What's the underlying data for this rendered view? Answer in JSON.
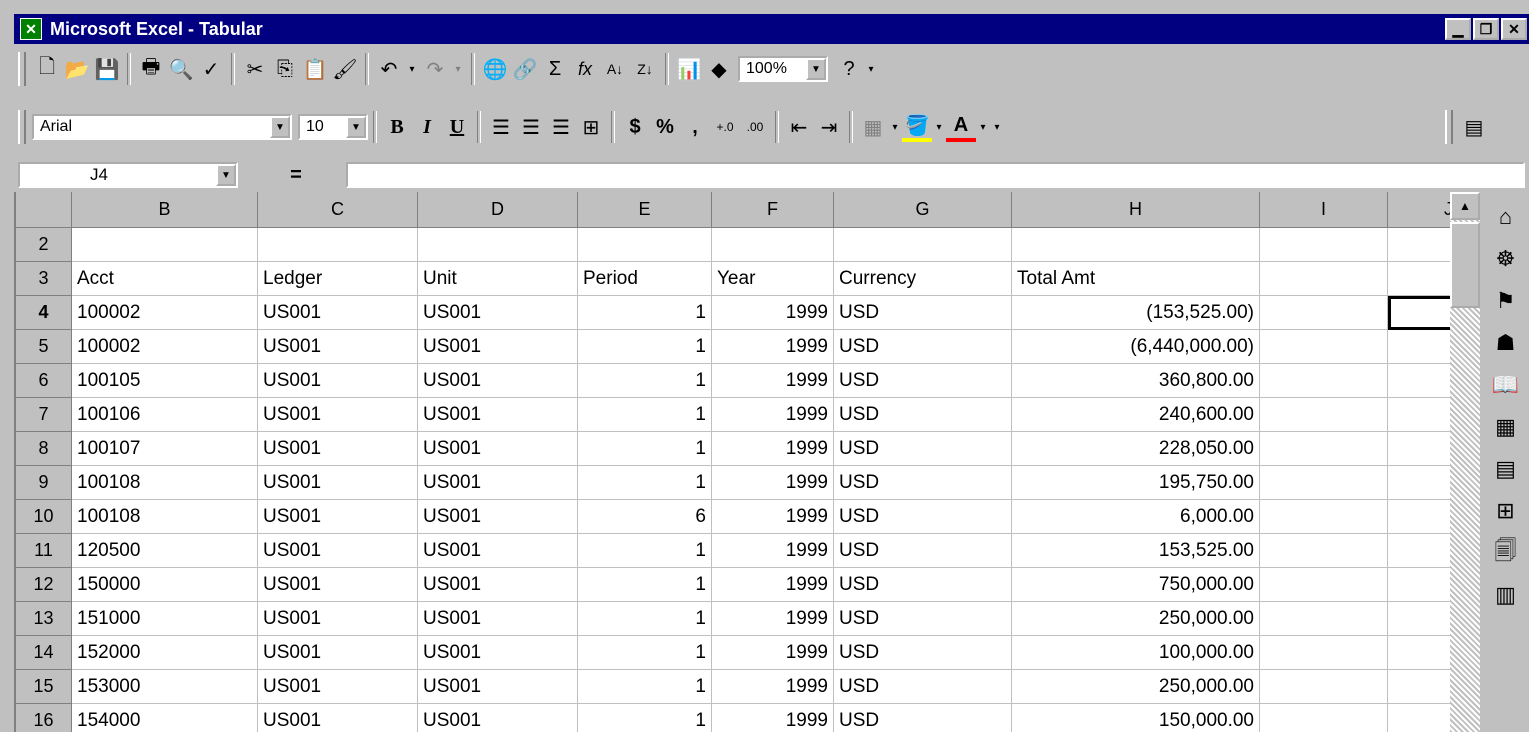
{
  "window": {
    "title": "Microsoft Excel - Tabular"
  },
  "toolbar": {
    "zoom": "100%"
  },
  "format": {
    "font": "Arial",
    "size": "10"
  },
  "formula": {
    "cell_ref": "J4",
    "eq": "="
  },
  "columns": [
    "B",
    "C",
    "D",
    "E",
    "F",
    "G",
    "H",
    "I",
    "J"
  ],
  "rows": [
    {
      "n": "2",
      "cells": [
        "",
        "",
        "",
        "",
        "",
        "",
        ""
      ]
    },
    {
      "n": "3",
      "cells": [
        "Acct",
        "Ledger",
        "Unit",
        "Period",
        "Year",
        "Currency",
        "Total Amt"
      ]
    },
    {
      "n": "4",
      "cells": [
        "100002",
        "US001",
        "US001",
        "1",
        "1999",
        "USD",
        "(153,525.00)"
      ]
    },
    {
      "n": "5",
      "cells": [
        "100002",
        "US001",
        "US001",
        "1",
        "1999",
        "USD",
        "(6,440,000.00)"
      ]
    },
    {
      "n": "6",
      "cells": [
        "100105",
        "US001",
        "US001",
        "1",
        "1999",
        "USD",
        "360,800.00"
      ]
    },
    {
      "n": "7",
      "cells": [
        "100106",
        "US001",
        "US001",
        "1",
        "1999",
        "USD",
        "240,600.00"
      ]
    },
    {
      "n": "8",
      "cells": [
        "100107",
        "US001",
        "US001",
        "1",
        "1999",
        "USD",
        "228,050.00"
      ]
    },
    {
      "n": "9",
      "cells": [
        "100108",
        "US001",
        "US001",
        "1",
        "1999",
        "USD",
        "195,750.00"
      ]
    },
    {
      "n": "10",
      "cells": [
        "100108",
        "US001",
        "US001",
        "6",
        "1999",
        "USD",
        "6,000.00"
      ]
    },
    {
      "n": "11",
      "cells": [
        "120500",
        "US001",
        "US001",
        "1",
        "1999",
        "USD",
        "153,525.00"
      ]
    },
    {
      "n": "12",
      "cells": [
        "150000",
        "US001",
        "US001",
        "1",
        "1999",
        "USD",
        "750,000.00"
      ]
    },
    {
      "n": "13",
      "cells": [
        "151000",
        "US001",
        "US001",
        "1",
        "1999",
        "USD",
        "250,000.00"
      ]
    },
    {
      "n": "14",
      "cells": [
        "152000",
        "US001",
        "US001",
        "1",
        "1999",
        "USD",
        "100,000.00"
      ]
    },
    {
      "n": "15",
      "cells": [
        "153000",
        "US001",
        "US001",
        "1",
        "1999",
        "USD",
        "250,000.00"
      ]
    },
    {
      "n": "16",
      "cells": [
        "154000",
        "US001",
        "US001",
        "1",
        "1999",
        "USD",
        "150,000.00"
      ]
    }
  ],
  "colors": {
    "titlebar": "#000080",
    "chrome": "#c0c0c0"
  }
}
